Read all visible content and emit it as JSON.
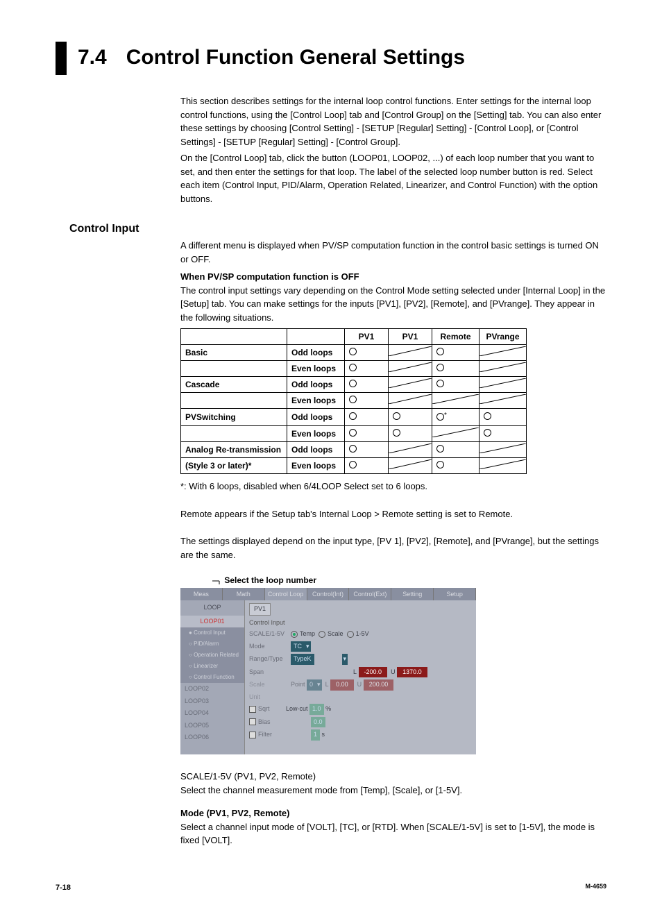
{
  "header": {
    "number": "7.4",
    "title": "Control Function General Settings"
  },
  "intro": {
    "p1": "This section describes settings for the internal loop control functions. Enter settings for the internal loop control functions, using the [Control Loop] tab and [Control Group] on the [Setting] tab.  You can also enter these settings by choosing [Control Setting] - [SETUP [Regular] Setting] - [Control Loop], or [Control Settings] - [SETUP [Regular] Setting] - [Control Group].",
    "p2": "On the [Control Loop] tab, click the button (LOOP01, LOOP02, ...) of each loop number that you want to set, and then enter the settings for that loop.  The label of the selected loop number button is red.  Select each item (Control Input, PID/Alarm, Operation Related, Linearizer, and Control Function) with the option buttons."
  },
  "control_input": {
    "heading": "Control Input",
    "p1": "A different menu is displayed when PV/SP computation function in the control basic settings is turned ON or OFF.",
    "sub1_title": "When PV/SP computation function is OFF",
    "sub1_p": "The control input settings vary depending on the Control Mode setting selected under [Internal Loop] in the [Setup] tab. You can make settings for the inputs [PV1], [PV2], [Remote], and [PVrange].  They appear in the following situations.",
    "table": {
      "headers": [
        "",
        "",
        "PV1",
        "PV1",
        "Remote",
        "PVrange"
      ],
      "rows": [
        {
          "c0": "Basic",
          "c1": "Odd loops",
          "pv1a": "O",
          "pv1b": "D",
          "remote": "O",
          "pvr": "D"
        },
        {
          "c0": "",
          "c1": "Even loops",
          "pv1a": "O",
          "pv1b": "D",
          "remote": "O",
          "pvr": "D"
        },
        {
          "c0": "Cascade",
          "c1": "Odd loops",
          "pv1a": "O",
          "pv1b": "D",
          "remote": "O",
          "pvr": "D"
        },
        {
          "c0": "",
          "c1": "Even loops",
          "pv1a": "O",
          "pv1b": "D",
          "remote": "D",
          "pvr": "D"
        },
        {
          "c0": "PVSwitching",
          "c1": "Odd loops",
          "pv1a": "O",
          "pv1b": "O",
          "remote": "O*",
          "pvr": "O"
        },
        {
          "c0": "",
          "c1": "Even loops",
          "pv1a": "O",
          "pv1b": "O",
          "remote": "D",
          "pvr": "O"
        },
        {
          "c0": "Analog Re-transmission",
          "c1": "Odd loops",
          "pv1a": "O",
          "pv1b": "D",
          "remote": "O",
          "pvr": "D"
        },
        {
          "c0": "(Style 3 or later)*",
          "c1": "Even loops",
          "pv1a": "O",
          "pv1b": "D",
          "remote": "O",
          "pvr": "D"
        }
      ]
    },
    "foot1": "*: With 6 loops, disabled when 6/4LOOP Select set to 6 loops.",
    "foot2": "Remote appears if the Setup tab's Internal Loop > Remote setting is set to Remote.",
    "foot3": "The settings displayed depend on the input type, [PV 1], [PV2], [Remote], and [PVrange], but the settings are the same.",
    "caption": "Select the loop number"
  },
  "screenshot": {
    "tabs": [
      "Meas",
      "Math",
      "Control Loop",
      "Control(Int)",
      "Control(Ext)",
      "Setting",
      "Setup"
    ],
    "side_title": "LOOP",
    "loops": [
      "LOOP01",
      "LOOP02",
      "LOOP03",
      "LOOP04",
      "LOOP05",
      "LOOP06"
    ],
    "loop01_items": [
      "Control Input",
      "PID/Alarm",
      "Operation Related",
      "Linearizer",
      "Control Function"
    ],
    "pv_tab": "PV1",
    "group_label": "Control Input",
    "scale_label": "SCALE/1-5V",
    "scale_opts": [
      "Temp",
      "Scale",
      "1-5V"
    ],
    "mode_label": "Mode",
    "mode_val": "TC",
    "range_label": "Range/Type",
    "range_val": "TypeK",
    "span_label": "Span",
    "span_L": "L",
    "span_Lv": "-200.0",
    "span_U": "U",
    "span_Uv": "1370.0",
    "scale2_label": "Scale",
    "point_label": "Point",
    "point_val": "0",
    "scale2_L": "L",
    "scale2_Lv": "0.00",
    "scale2_U": "U",
    "scale2_Uv": "200.00",
    "unit_label": "Unit",
    "sqrt_label": "Sqrt",
    "lowcut_label": "Low-cut",
    "lowcut_val": "1.0",
    "lowcut_unit": "%",
    "bias_label": "Bias",
    "bias_val": "0.0",
    "filter_label": "Filter",
    "filter_val": "1",
    "filter_unit": "s"
  },
  "after_fig": {
    "scale_line1": "SCALE/1-5V (PV1, PV2, Remote)",
    "scale_line2": "Select the channel measurement mode from [Temp], [Scale], or [1-5V].",
    "mode_title": "Mode (PV1, PV2, Remote)",
    "mode_body": "Select a channel input mode of [VOLT], [TC], or [RTD].  When [SCALE/1-5V] is set to [1-5V], the mode is fixed [VOLT]."
  },
  "footer": {
    "page": "7-18",
    "doc": "M-4659"
  }
}
